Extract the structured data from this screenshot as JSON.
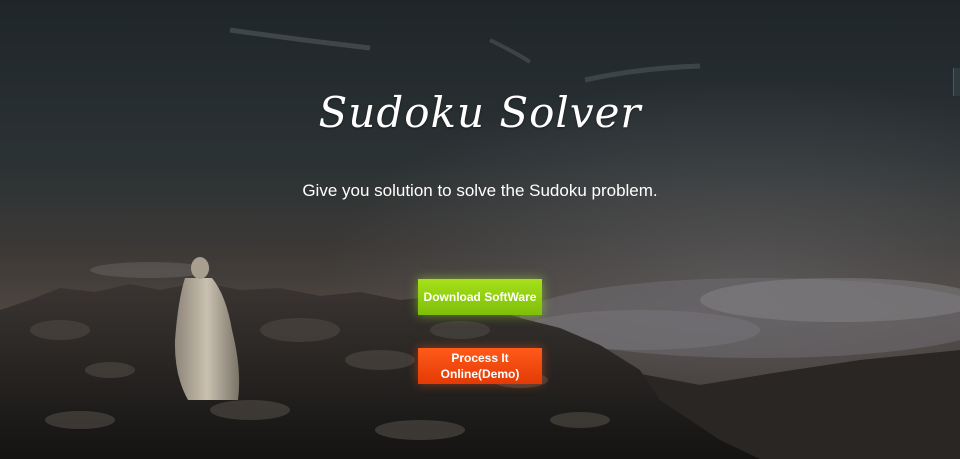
{
  "hero": {
    "title": "Sudoku Solver",
    "subtitle": "Give you solution to solve the Sudoku problem."
  },
  "actions": {
    "download_label": "Download SoftWare",
    "process_label_line1": "Process It",
    "process_label_line2": "Online(Demo)"
  },
  "colors": {
    "download_button": "#8fd10f",
    "process_button": "#f24a0d",
    "text": "#ffffff"
  }
}
